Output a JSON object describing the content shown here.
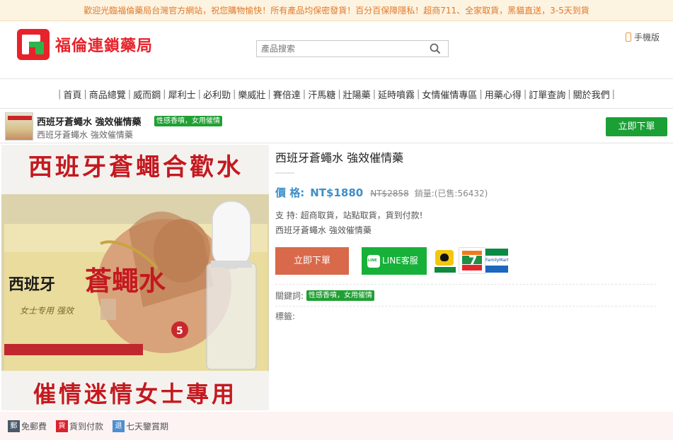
{
  "notice": "歡迎光臨福倫藥局台灣官方網站，祝您購物愉快！所有產品均保密發貨！百分百保障隱私！超商711、全家取貨，黑貓直送，3-5天到貨",
  "header": {
    "logo_text": "福倫連鎖藥局",
    "search_placeholder": "產品搜索",
    "mobile_label": "手機版"
  },
  "nav": {
    "items": [
      "首頁",
      "商品總覽",
      "威而鋼",
      "犀利士",
      "必利勁",
      "樂威壯",
      "賽倍達",
      "汗馬糖",
      "壯陽藥",
      "延時噴霧",
      "女情催情專區",
      "用藥心得",
      "訂單查詢",
      "關於我們"
    ]
  },
  "strip": {
    "title": "西班牙蒼蠅水 強效催情藥",
    "tag": "性感香噴，女用催情",
    "subtitle": "西班牙蒼蠅水 強效催情藥",
    "buy_label": "立即下單"
  },
  "image": {
    "top_banner": "西班牙蒼蠅合歡水",
    "box_brand": "西班牙",
    "box_name": "蒼蠅水",
    "box_sub": "女士专用 强效",
    "bottom_banner": "催情迷情女士專用"
  },
  "product": {
    "title": "西班牙蒼蠅水 強效催情藥",
    "price_label": "價 格:",
    "price_now": "NT$1880",
    "price_old": "NT$2858",
    "sales": "銷量:(已售:56432)",
    "support": "支 持:  超商取貨，站點取貨，貨到付款!",
    "description": "西班牙蒼蠅水 強效催情藥",
    "buy_label": "立即下單",
    "line_label": "LINE客服",
    "keywords_label": "關鍵詞:",
    "keyword_tag": "性感香噴，女用催情",
    "tags_label": "標籤:"
  },
  "delivery": {
    "seven_number": "7",
    "family_text": "FamilyMart"
  },
  "service": {
    "items": [
      {
        "badge": "郵",
        "label": "免郵費",
        "color": "#4a5a6a"
      },
      {
        "badge": "貨",
        "label": "貨到付款",
        "color": "#d9232d"
      },
      {
        "badge": "退",
        "label": "七天鑒賞期",
        "color": "#4d8fd1"
      }
    ]
  },
  "colors": {
    "notice_text": "#e07a2a",
    "brand_red": "#e8222b",
    "green": "#1aa035",
    "price_blue": "#3d8ec9",
    "buy_orange": "#d8694b"
  }
}
